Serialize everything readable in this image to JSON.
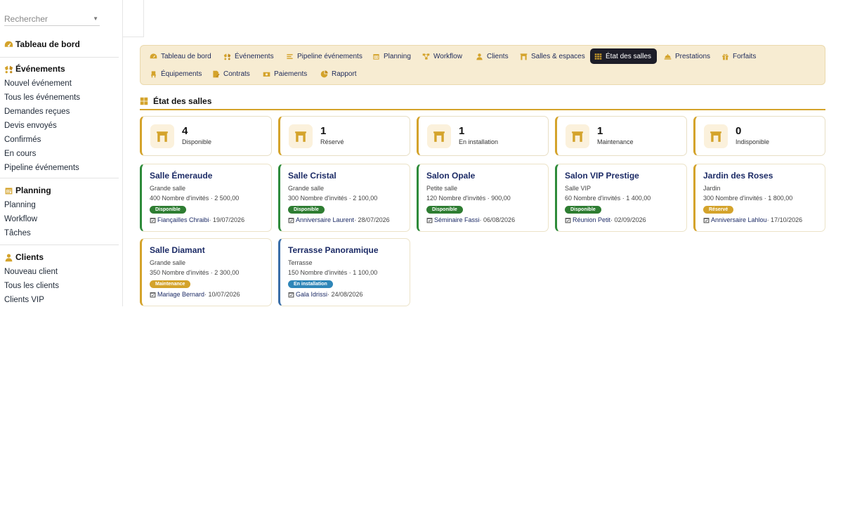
{
  "search": {
    "placeholder": "Rechercher"
  },
  "sidebar": {
    "dashboard": "Tableau de bord",
    "events": {
      "title": "Événements",
      "items": [
        "Nouvel événement",
        "Tous les événements",
        "Demandes reçues",
        "Devis envoyés",
        "Confirmés",
        "En cours",
        "Pipeline événements"
      ]
    },
    "planning": {
      "title": "Planning",
      "items": [
        "Planning",
        "Workflow",
        "Tâches"
      ]
    },
    "clients": {
      "title": "Clients",
      "items": [
        "Nouveau client",
        "Tous les clients",
        "Clients VIP"
      ]
    }
  },
  "tabs": [
    {
      "label": "Tableau de bord",
      "icon": "dashboard-icon"
    },
    {
      "label": "Événements",
      "icon": "events-icon"
    },
    {
      "label": "Pipeline événements",
      "icon": "pipeline-icon"
    },
    {
      "label": "Planning",
      "icon": "calendar-icon"
    },
    {
      "label": "Workflow",
      "icon": "workflow-icon"
    },
    {
      "label": "Clients",
      "icon": "user-icon"
    },
    {
      "label": "Salles & espaces",
      "icon": "venue-icon"
    },
    {
      "label": "État des salles",
      "icon": "grid-icon",
      "active": true
    },
    {
      "label": "Prestations",
      "icon": "service-icon"
    },
    {
      "label": "Forfaits",
      "icon": "gift-icon"
    },
    {
      "label": "Équipements",
      "icon": "chair-icon"
    },
    {
      "label": "Contrats",
      "icon": "contract-icon"
    },
    {
      "label": "Paiements",
      "icon": "money-icon"
    },
    {
      "label": "Rapport",
      "icon": "report-icon"
    }
  ],
  "page": {
    "title": "État des salles"
  },
  "stats": [
    {
      "value": "4",
      "label": "Disponible"
    },
    {
      "value": "1",
      "label": "Réservé"
    },
    {
      "value": "1",
      "label": "En installation"
    },
    {
      "value": "1",
      "label": "Maintenance"
    },
    {
      "value": "0",
      "label": "Indisponible"
    }
  ],
  "rooms": [
    {
      "name": "Salle Émeraude",
      "type": "Grande salle",
      "info": "400 Nombre d'invités · 2 500,00",
      "status": "Disponible",
      "event": "Fiançailles Chraibi",
      "date": " · 19/07/2026"
    },
    {
      "name": "Salle Cristal",
      "type": "Grande salle",
      "info": "300 Nombre d'invités · 2 100,00",
      "status": "Disponible",
      "event": "Anniversaire Laurent",
      "date": " · 28/07/2026"
    },
    {
      "name": "Salon Opale",
      "type": "Petite salle",
      "info": "120 Nombre d'invités · 900,00",
      "status": "Disponible",
      "event": "Séminaire Fassi",
      "date": " · 06/08/2026"
    },
    {
      "name": "Salon VIP Prestige",
      "type": "Salle VIP",
      "info": "60 Nombre d'invités · 1 400,00",
      "status": "Disponible",
      "event": "Réunion Petit",
      "date": " · 02/09/2026"
    },
    {
      "name": "Jardin des Roses",
      "type": "Jardin",
      "info": "300 Nombre d'invités · 1 800,00",
      "status": "Réservé",
      "event": "Anniversaire Lahlou",
      "date": " · 17/10/2026"
    },
    {
      "name": "Salle Diamant",
      "type": "Grande salle",
      "info": "350 Nombre d'invités · 2 300,00",
      "status": "Maintenance",
      "event": "Mariage Bernard",
      "date": " · 10/07/2026"
    },
    {
      "name": "Terrasse Panoramique",
      "type": "Terrasse",
      "info": "150 Nombre d'invités · 1 100,00",
      "status": "En installation",
      "event": "Gala Idrissi",
      "date": " · 24/08/2026"
    }
  ],
  "colors": {
    "accent": "#d4a32b",
    "available": "#2e7d32",
    "installing": "#2f86b8",
    "navy": "#1c2b66",
    "tabbar": "#f7ecd2"
  }
}
